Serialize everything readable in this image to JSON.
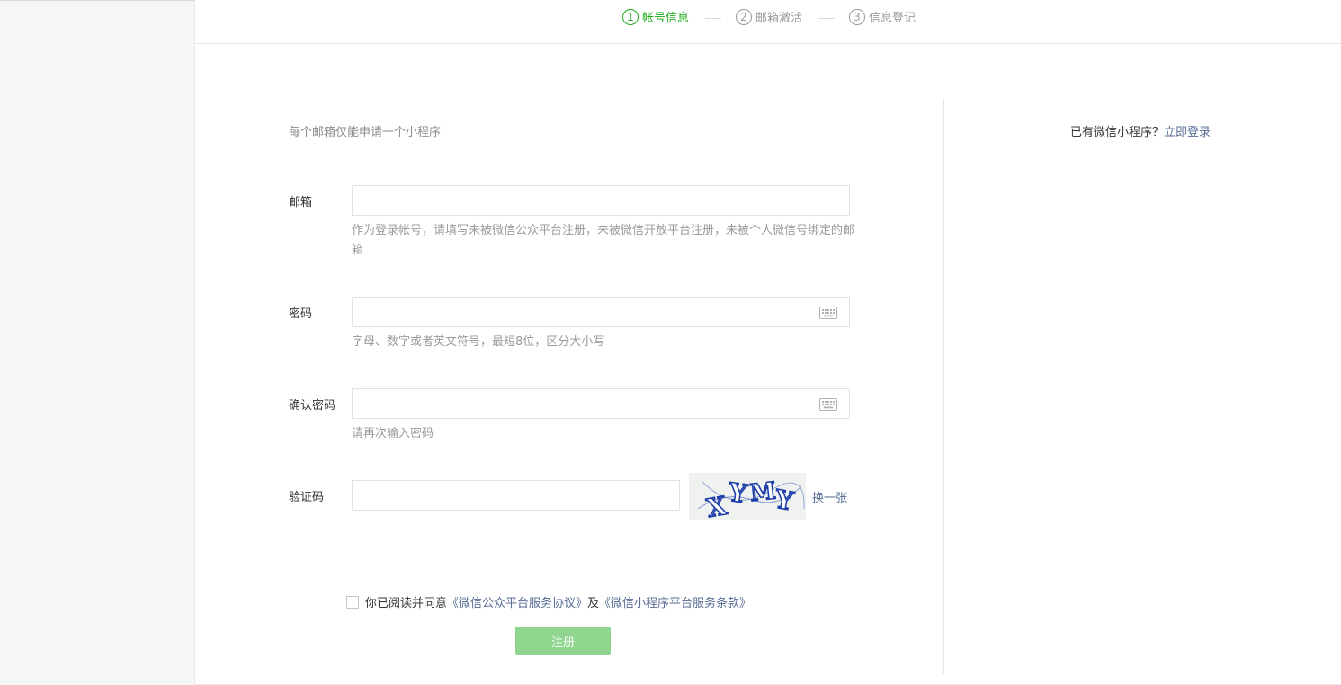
{
  "steps": [
    {
      "num": "1",
      "label": "帐号信息",
      "active": true
    },
    {
      "num": "2",
      "label": "邮箱激活",
      "active": false
    },
    {
      "num": "3",
      "label": "信息登记",
      "active": false
    }
  ],
  "tip": "每个邮箱仅能申请一个小程序",
  "login_hint": {
    "text": "已有微信小程序？",
    "link": "立即登录"
  },
  "form": {
    "email": {
      "label": "邮箱",
      "value": "",
      "hint": "作为登录帐号，请填写未被微信公众平台注册，未被微信开放平台注册，未被个人微信号绑定的邮箱"
    },
    "password": {
      "label": "密码",
      "value": "",
      "hint": "字母、数字或者英文符号，最短8位，区分大小写"
    },
    "confirm": {
      "label": "确认密码",
      "value": "",
      "hint": "请再次输入密码"
    },
    "captcha": {
      "label": "验证码",
      "value": "",
      "image_text": "XYMY",
      "refresh": "换一张"
    }
  },
  "agreement": {
    "prefix": "你已阅读并同意",
    "link1": "《微信公众平台服务协议》",
    "middle": "及",
    "link2": "《微信小程序平台服务条款》",
    "checked": false
  },
  "submit_label": "注册",
  "colors": {
    "accent": "#1aad19",
    "link": "#576b95",
    "button_disabled": "#8fd58e"
  }
}
